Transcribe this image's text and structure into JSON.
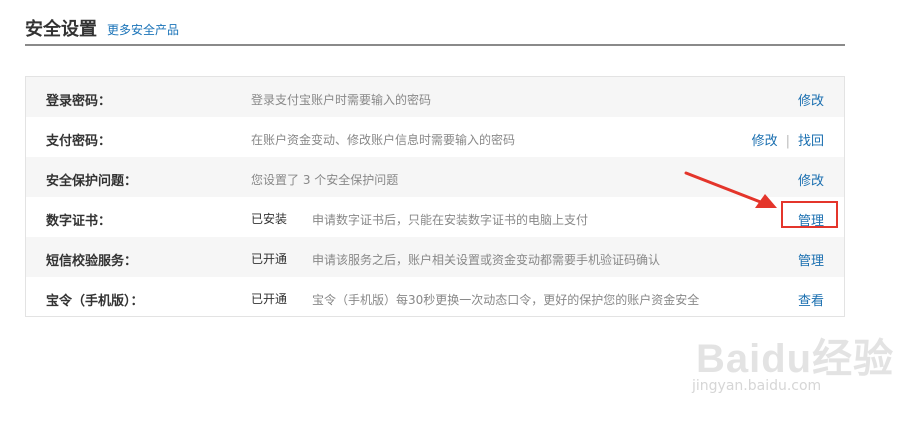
{
  "header": {
    "title": "安全设置",
    "more_link": "更多安全产品"
  },
  "rows": [
    {
      "name": "登录密码：",
      "status": "",
      "desc": "登录支付宝账户时需要输入的密码",
      "actions": [
        "修改"
      ]
    },
    {
      "name": "支付密码：",
      "status": "",
      "desc": "在账户资金变动、修改账户信息时需要输入的密码",
      "actions": [
        "修改",
        "找回"
      ]
    },
    {
      "name": "安全保护问题：",
      "status": "",
      "desc": "您设置了 3 个安全保护问题",
      "actions": [
        "修改"
      ]
    },
    {
      "name": "数字证书：",
      "status": "已安装",
      "desc": "申请数字证书后，只能在安装数字证书的电脑上支付",
      "actions": [
        "管理"
      ]
    },
    {
      "name": "短信校验服务：",
      "status": "已开通",
      "desc": "申请该服务之后，账户相关设置或资金变动都需要手机验证码确认",
      "actions": [
        "管理"
      ]
    },
    {
      "name": "宝令（手机版）：",
      "status": "已开通",
      "desc": "宝令（手机版）每30秒更换一次动态口令，更好的保护您的账户资金安全",
      "actions": [
        "查看"
      ]
    }
  ],
  "action_separator": "|",
  "watermark": {
    "logo": "Baidu经验",
    "url": "jingyan.baidu.com"
  },
  "colors": {
    "link": "#1a6fb0",
    "highlight": "#e4352b",
    "alt_row": "#f6f6f6"
  }
}
